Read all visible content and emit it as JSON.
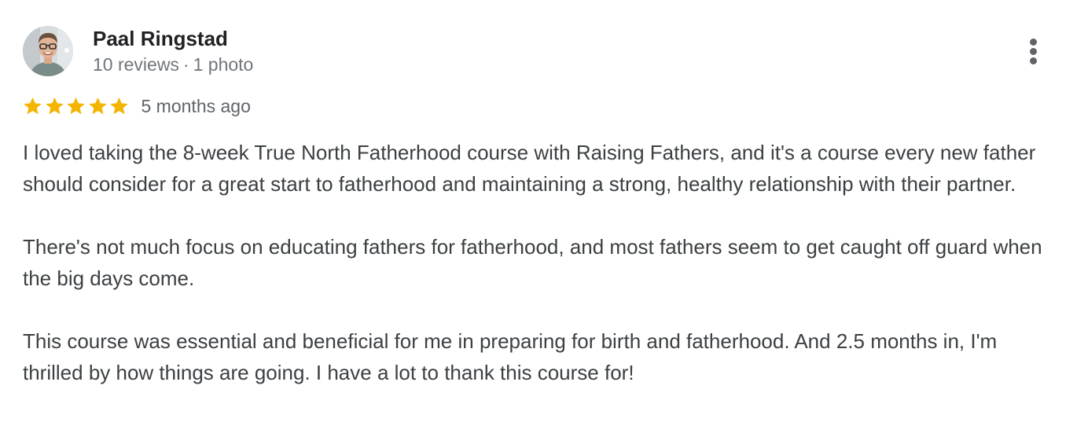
{
  "reviewer": {
    "name": "Paal Ringstad",
    "reviews_count": "10 reviews",
    "meta_separator": "·",
    "photos_count": "1 photo",
    "avatar_icon": "person-photo-avatar"
  },
  "review": {
    "rating": 5,
    "rating_max": 5,
    "star_color": "#f4b400",
    "date": "5 months ago",
    "paragraphs": [
      "I loved taking the 8-week True North Fatherhood course with Raising Fathers, and it's a course every new father should consider for a great start to fatherhood and maintaining a strong, healthy relationship with their partner.",
      "There's not much focus on educating fathers for fatherhood, and most fathers seem to get caught off guard when the big days come.",
      "This course was essential and beneficial for me in preparing for birth and fatherhood. And 2.5 months in, I'm thrilled by how things are going. I have a lot to thank this course for!"
    ]
  },
  "actions": {
    "more_icon": "more-vertical-icon"
  }
}
